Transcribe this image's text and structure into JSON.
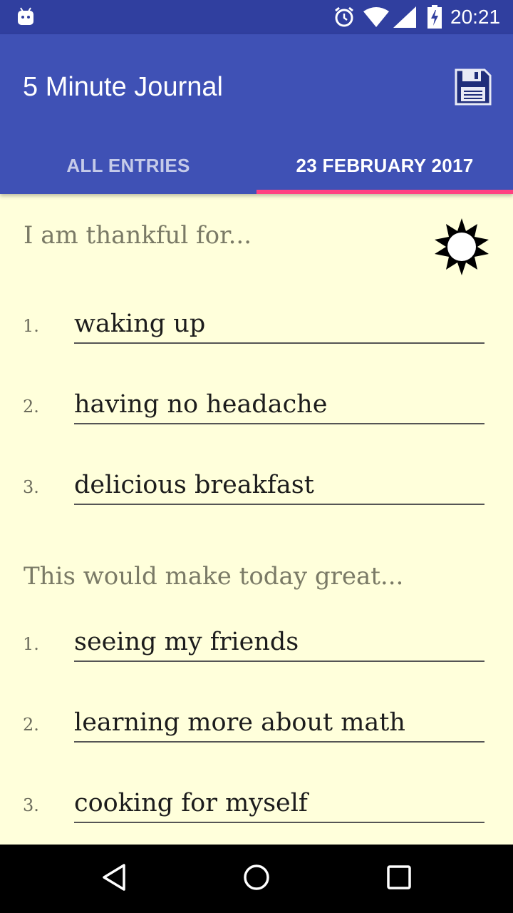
{
  "status_bar": {
    "time": "20:21",
    "icons": [
      "android-icon",
      "alarm-icon",
      "wifi-icon",
      "signal-icon",
      "battery-charging-icon"
    ]
  },
  "app_bar": {
    "title": "5 Minute Journal",
    "action_icon": "save-icon",
    "tabs": [
      {
        "label": "ALL ENTRIES",
        "selected": false
      },
      {
        "label": "23 FEBRUARY 2017",
        "selected": true
      }
    ],
    "accent_color": "#FF4081",
    "primary_color": "#3F51B5"
  },
  "thankful": {
    "heading": "I am thankful for...",
    "icon": "sun-icon",
    "items": [
      {
        "num": "1.",
        "text": "waking up"
      },
      {
        "num": "2.",
        "text": "having no headache"
      },
      {
        "num": "3.",
        "text": "delicious breakfast"
      }
    ]
  },
  "great": {
    "heading": "This would make today great...",
    "items": [
      {
        "num": "1.",
        "text": "seeing my friends"
      },
      {
        "num": "2.",
        "text": "learning more about math"
      },
      {
        "num": "3.",
        "text": "cooking for myself"
      }
    ]
  },
  "nav_bar": {
    "icons": [
      "back-icon",
      "home-icon",
      "recents-icon"
    ]
  }
}
